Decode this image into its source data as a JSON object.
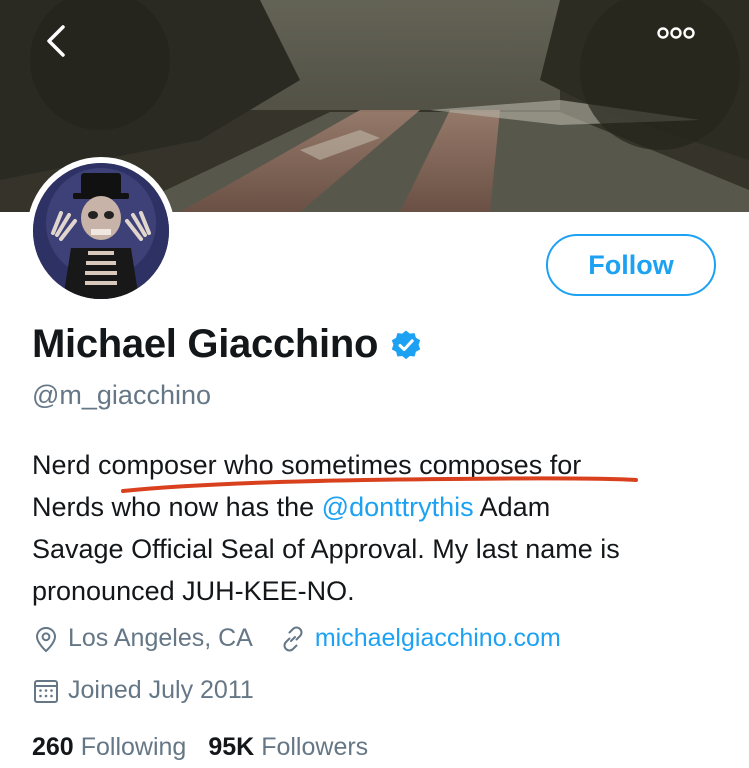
{
  "header": {
    "back_icon": "chevron-left-icon",
    "more_icon": "more-horizontal-icon"
  },
  "profile": {
    "name": "Michael Giacchino",
    "handle": "@m_giacchino",
    "verified": true,
    "follow_label": "Follow",
    "bio": {
      "line1": "Nerd composer who sometimes composes for",
      "line2_pre": "Nerds who now has the ",
      "mention": "@donttrythis",
      "line2_post": " Adam",
      "line3": "Savage Official Seal of Approval. My last name is",
      "line4": "pronounced JUH-KEE-NO."
    },
    "location": "Los Angeles, CA",
    "website": "michaelgiacchino.com",
    "joined": "Joined July 2011",
    "following_count": "260",
    "following_label": "Following",
    "followers_count": "95K",
    "followers_label": "Followers"
  },
  "colors": {
    "accent": "#1da1f2",
    "secondary_text": "#657786",
    "annotation": "#d9411e"
  }
}
